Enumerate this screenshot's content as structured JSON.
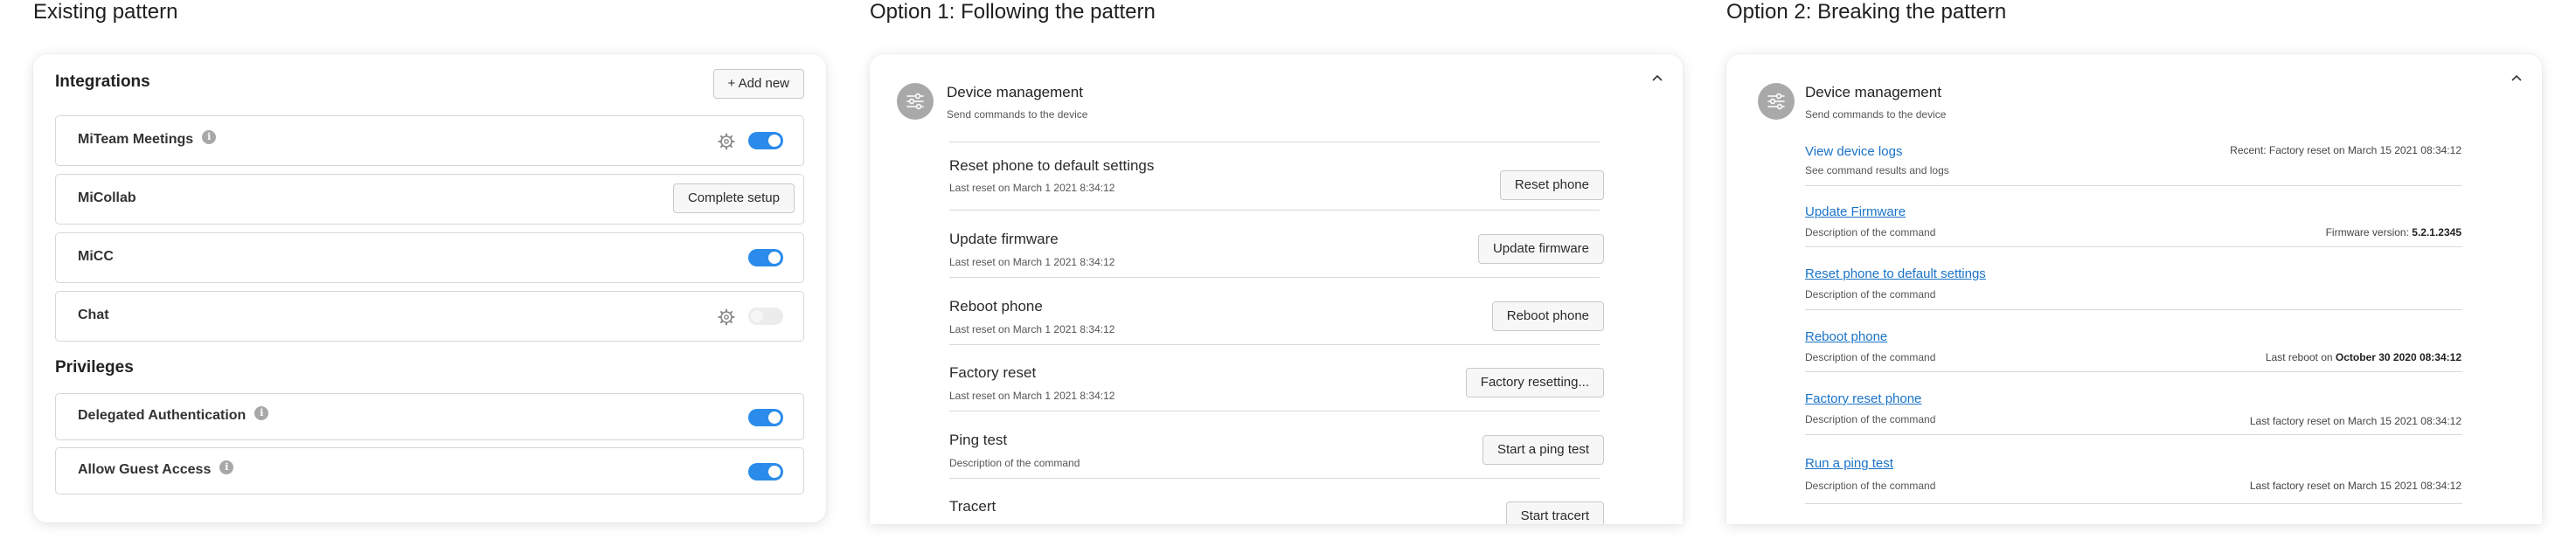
{
  "columns": {
    "existing_title": "Existing pattern",
    "option1_title": "Option 1: Following the pattern",
    "option2_title": "Option 2: Breaking the pattern"
  },
  "existing": {
    "integrations_heading": "Integrations",
    "add_new_label": "+ Add new",
    "integrations": [
      {
        "name": "MiTeam Meetings",
        "info": true,
        "gear": true,
        "toggle": "on"
      },
      {
        "name": "MiCollab",
        "button": "Complete setup"
      },
      {
        "name": "MiCC",
        "toggle": "on"
      },
      {
        "name": "Chat",
        "gear": true,
        "toggle": "off"
      }
    ],
    "privileges_heading": "Privileges",
    "privileges": [
      {
        "name": "Delegated Authentication",
        "info": true,
        "toggle": "on"
      },
      {
        "name": "Allow Guest Access",
        "info": true,
        "toggle": "on"
      }
    ],
    "info_glyph": "i"
  },
  "option1": {
    "title": "Device management",
    "subtitle": "Send commands to the device",
    "commands": [
      {
        "name": "Reset phone to default settings",
        "sub": "Last reset on March 1 2021 8:34:12",
        "button": "Reset phone"
      },
      {
        "name": "Update firmware",
        "sub": "Last reset on March 1 2021 8:34:12",
        "button": "Update firmware"
      },
      {
        "name": "Reboot phone",
        "sub": "Last reset on March 1 2021 8:34:12",
        "button": "Reboot phone"
      },
      {
        "name": "Factory reset",
        "sub": "Last reset on March 1 2021 8:34:12",
        "button": "Factory resetting..."
      },
      {
        "name": "Ping test",
        "sub": "Description of the command",
        "button": "Start a ping test"
      },
      {
        "name": "Tracert",
        "sub": "",
        "button": "Start tracert"
      }
    ]
  },
  "option2": {
    "title": "Device management",
    "subtitle": "Send commands to the device",
    "commands": [
      {
        "name": "View device logs",
        "sub": "See command results and logs",
        "meta_pre": "Recent: Factory reset on March 15 2021 08:34:12",
        "meta_bold": "",
        "underline": false
      },
      {
        "name": "Update Firmware",
        "sub": "Description of the command",
        "meta_pre": "Firmware version: ",
        "meta_bold": "5.2.1.2345",
        "underline": true
      },
      {
        "name": "Reset phone to default settings",
        "sub": "Description of the command",
        "meta_pre": "",
        "meta_bold": "",
        "underline": true
      },
      {
        "name": "Reboot phone",
        "sub": "Description of the command",
        "meta_pre": "Last reboot on ",
        "meta_bold": "October 30 2020 08:34:12",
        "underline": true
      },
      {
        "name": "Factory reset phone",
        "sub": "Description of the command",
        "meta_pre": "Last factory reset on March 15 2021 08:34:12",
        "meta_bold": "",
        "underline": true
      },
      {
        "name": "Run a ping test",
        "sub": "Description of the command",
        "meta_pre": "Last factory reset on March 15 2021 08:34:12",
        "meta_bold": "",
        "underline": true
      }
    ]
  },
  "colors": {
    "toggle_on": "#2a8bea",
    "link": "#1a73c8",
    "avatar": "#a9a9a9"
  }
}
